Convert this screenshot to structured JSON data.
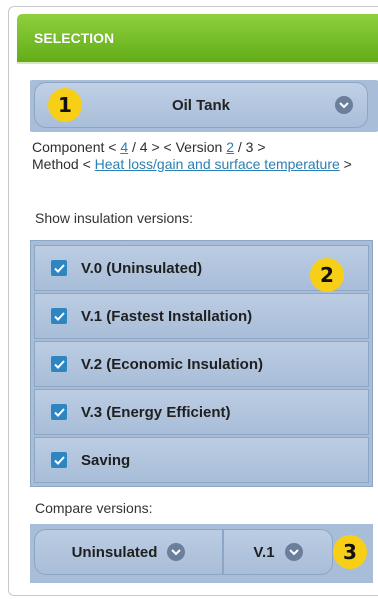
{
  "header": {
    "title": "SELECTION"
  },
  "component_select": {
    "value": "Oil Tank",
    "icon": "chevron-down-icon"
  },
  "badges": [
    "1",
    "2",
    "3"
  ],
  "nav": {
    "component_prefix": "Component < ",
    "component_current": "4",
    "component_mid": " / 4 > < Version ",
    "version_current": "2",
    "version_suffix": " / 3 >",
    "method_prefix": "Method < ",
    "method_link": "Heat loss/gain and surface temperature",
    "method_suffix": " >"
  },
  "show_label": "Show insulation versions:",
  "versions": [
    {
      "label": "V.0 (Uninsulated)",
      "checked": true
    },
    {
      "label": "V.1 (Fastest Installation)",
      "checked": true
    },
    {
      "label": "V.2 (Economic Insulation)",
      "checked": true
    },
    {
      "label": "V.3 (Energy Efficient)",
      "checked": true
    },
    {
      "label": "Saving",
      "checked": true
    }
  ],
  "compare_label": "Compare versions:",
  "compare": {
    "left": "Uninsulated",
    "right": "V.1"
  },
  "colors": {
    "header_green": "#6fbb22",
    "accent_blue": "#2e86c1",
    "badge_yellow": "#f8cf17",
    "box_blue": "#a7bdd8"
  }
}
